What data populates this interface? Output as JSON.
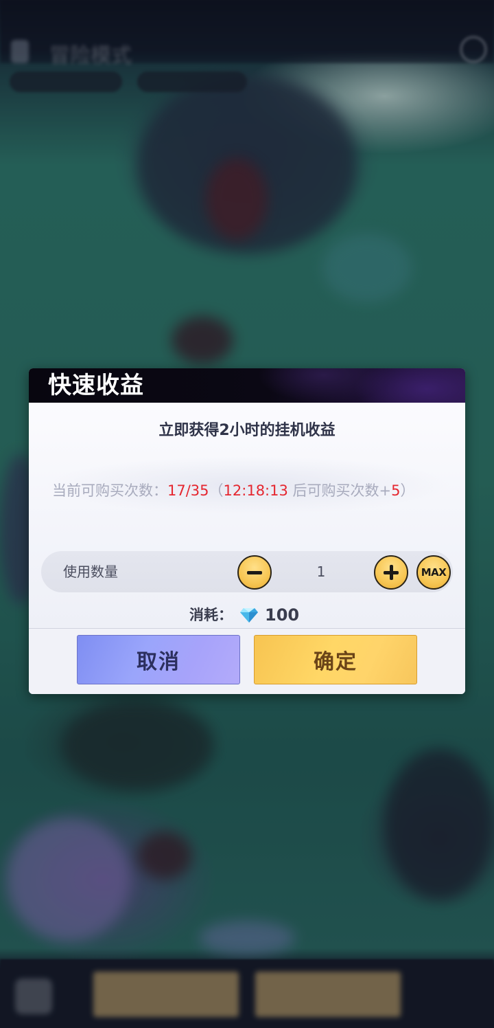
{
  "background": {
    "top_title": "冒险模式",
    "bottom_left_button": "",
    "bottom_right_button": ""
  },
  "dialog": {
    "title": "快速收益",
    "headline": "立即获得2小时的挂机收益",
    "count_prefix": "当前可购买次数：",
    "count_value": "17/35",
    "open_paren": "（",
    "timer": "12:18:13",
    "timer_suffix": " 后可购买次数+",
    "bonus": "5",
    "close_paren": "）",
    "quantity_label": "使用数量",
    "quantity_value": "1",
    "max_label": "MAX",
    "cost_label": "消耗：",
    "cost_value": "100",
    "cost_icon": "diamond-icon",
    "cancel_label": "取消",
    "confirm_label": "确定"
  },
  "colors": {
    "header": "#0b0814",
    "highlight_red": "#e5262f",
    "cancel_button": "#9aa5fb",
    "confirm_button": "#ffd766",
    "round_button": "#f7c653"
  }
}
